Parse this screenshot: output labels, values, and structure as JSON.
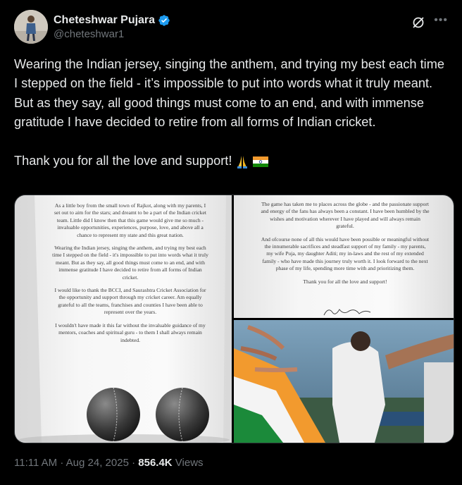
{
  "author": {
    "name": "Cheteshwar Pujara",
    "handle": "@cheteshwar1"
  },
  "tweet": {
    "text": "Wearing the Indian jersey, singing the anthem, and trying my best each time I stepped on the field - it’s impossible to put into words what it truly meant. But as they say, all good things must come to an end, and with immense gratitude I have decided to retire from all forms of Indian cricket.\n\nThank you for all the love and support!",
    "emojis": [
      "folded-hands",
      "india-flag"
    ]
  },
  "images": {
    "letter_left": [
      "As a little boy from the small town of Rajkot, along with my parents, I set out to aim for the stars; and dreamt to be a part of the Indian cricket team. Little did I know then that this game would give me so much - invaluable opportunities, experiences, purpose, love, and above all a chance to represent my state and this great nation.",
      "Wearing the Indian jersey, singing the anthem, and trying my best each time I stepped on the field - it's impossible to put into words what it truly meant. But as they say, all good things must come to an end, and with immense gratitude I have decided to retire from all forms of Indian cricket.",
      "I would like to thank the BCCI, and Saurashtra Cricket Association for the opportunity and support through my cricket career. Am equally grateful to all the teams, franchises and counties I have been able to represent over the years.",
      "I wouldn't have made it this far without the invaluable guidance of my mentors, coaches and spiritual guru - to them I shall always remain indebted."
    ],
    "letter_right": [
      "The game has taken me to places across the globe - and the passionate support and energy of the fans has always been a constant. I have been humbled by the wishes and motivation wherever I have played and will always remain grateful.",
      "And ofcourse none of all this would have been possible or meaningful without the innumerable sacrifices and steadfast support of my family - my parents, my wife Puja, my daughter Aditi; my in-laws and the rest of my extended family - who have made this journey truly worth it. I look forward to the next phase of my life, spending more time with and prioritizing them.",
      "Thank you for all the love and support!"
    ]
  },
  "meta": {
    "time": "11:11 AM",
    "separator1": " · ",
    "date": "Aug 24, 2025",
    "separator2": " · ",
    "views_count": "856.4K",
    "views_label": " Views"
  },
  "colors": {
    "background": "#000000",
    "text": "#e7e9ea",
    "muted": "#71767b",
    "verified": "#1d9bf0"
  }
}
